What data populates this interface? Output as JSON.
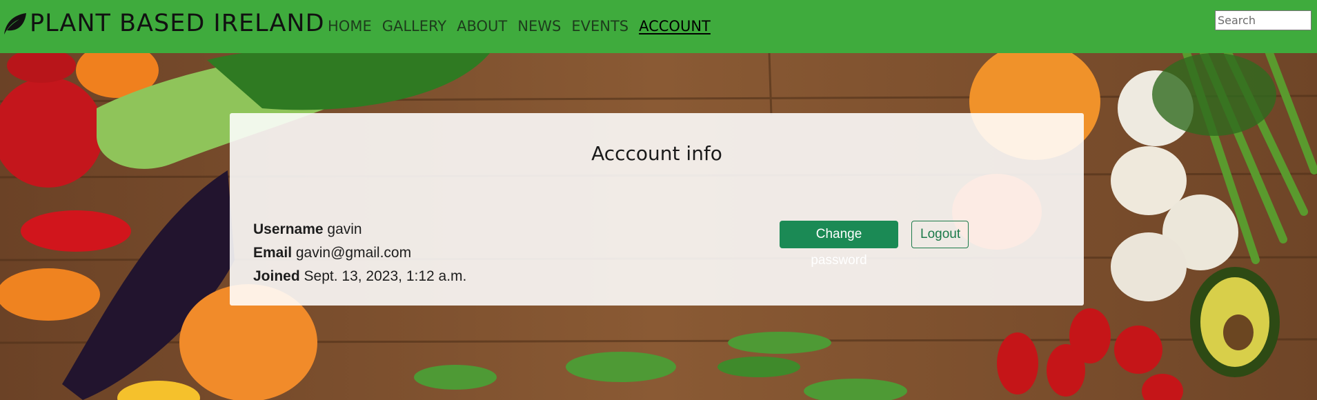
{
  "brand": {
    "name": "PLANT BASED IRELAND",
    "logo_icon": "leaf-icon"
  },
  "nav": {
    "items": [
      {
        "label": "HOME",
        "active": false
      },
      {
        "label": "GALLERY",
        "active": false
      },
      {
        "label": "ABOUT",
        "active": false
      },
      {
        "label": "NEWS",
        "active": false
      },
      {
        "label": "EVENTS",
        "active": false
      },
      {
        "label": "ACCOUNT",
        "active": true
      }
    ]
  },
  "search": {
    "placeholder": "Search",
    "value": ""
  },
  "account": {
    "title": "Acccount info",
    "username_label": "Username",
    "username": "gavin",
    "email_label": "Email",
    "email": "gavin@gmail.com",
    "joined_label": "Joined",
    "joined": "Sept. 13, 2023, 1:12 a.m.",
    "change_password_label": "Change password",
    "logout_label": "Logout"
  },
  "colors": {
    "navbar": "#3fab3d",
    "primary_button": "#1b8a55",
    "outline_button": "#1b7a49",
    "card_background": "#ffffff"
  }
}
